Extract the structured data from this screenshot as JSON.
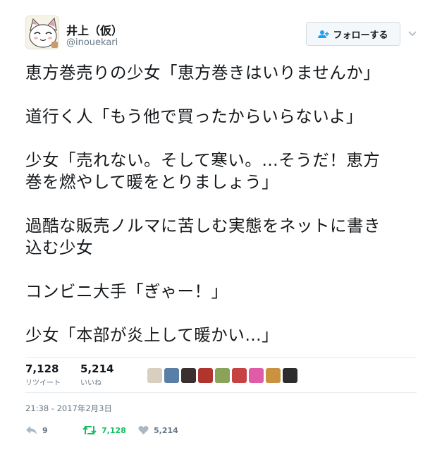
{
  "user": {
    "name": "井上（仮）",
    "handle": "@inouekari"
  },
  "follow_button": {
    "label": "フォローする"
  },
  "tweet": {
    "paragraphs": [
      [
        "恵方巻売りの少女「恵方巻きはいりませんか」"
      ],
      [
        "道行く人「もう他で買ったからいらないよ」"
      ],
      [
        "少女「売れない。そして寒い。…そうだ！恵方",
        "巻を燃やして暖をとりましょう」"
      ],
      [
        "過酷な販売ノルマに苦しむ実態をネットに書き",
        "込む少女"
      ],
      [
        "コンビニ大手「ぎゃー！」"
      ],
      [
        "少女「本部が炎上して暖かい…」"
      ]
    ]
  },
  "stats": {
    "retweets": {
      "value": "7,128",
      "label": "リツイート"
    },
    "likes": {
      "value": "5,214",
      "label": "いいね"
    }
  },
  "liker_avatars": [
    {
      "name": "avatar-1",
      "color": "#d8cfc0"
    },
    {
      "name": "avatar-2",
      "color": "#5a7fa6"
    },
    {
      "name": "avatar-3",
      "color": "#3a3030"
    },
    {
      "name": "avatar-4",
      "color": "#b0352e"
    },
    {
      "name": "avatar-5",
      "color": "#8aa35a"
    },
    {
      "name": "avatar-6",
      "color": "#c74343"
    },
    {
      "name": "avatar-7",
      "color": "#e05ca8"
    },
    {
      "name": "avatar-8",
      "color": "#c8923e"
    },
    {
      "name": "avatar-9",
      "color": "#2d2d2d"
    }
  ],
  "timestamp": "21:38 - 2017年2月3日",
  "actions": {
    "reply": {
      "count": "9",
      "color": "#657786"
    },
    "retweet": {
      "count": "7,128",
      "color": "#17bf63"
    },
    "like": {
      "count": "5,214",
      "color": "#657786"
    }
  }
}
